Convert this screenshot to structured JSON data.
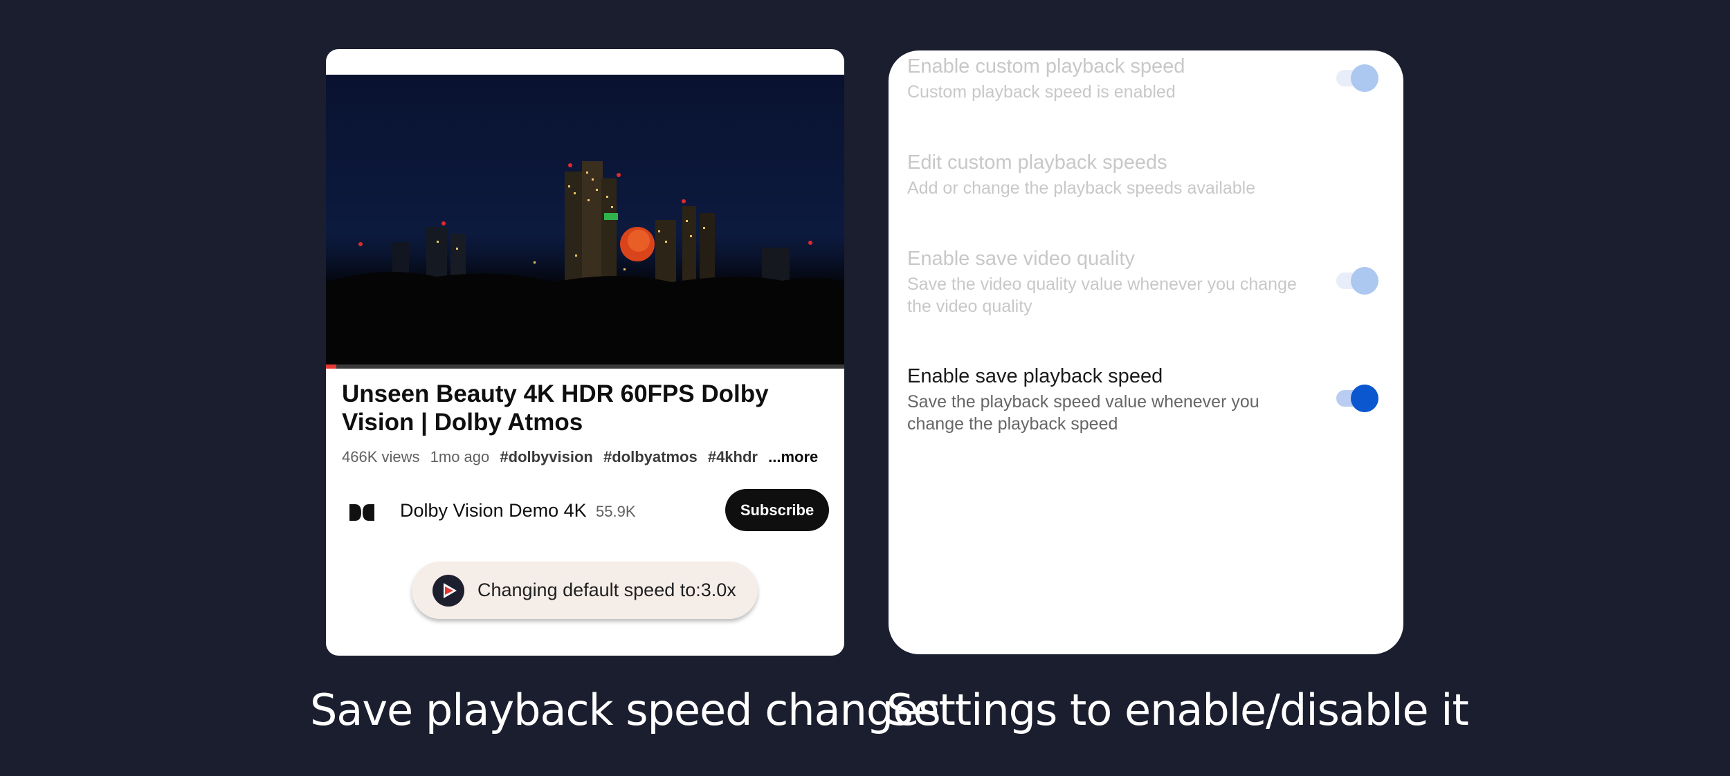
{
  "video": {
    "title": "Unseen Beauty 4K HDR 60FPS Dolby Vision | Dolby Atmos",
    "views": "466K views",
    "age": "1mo ago",
    "tags": [
      "#dolbyvision",
      "#dolbyatmos",
      "#4khdr"
    ],
    "more_label": "...more",
    "progress": 0.02
  },
  "channel": {
    "name": "Dolby Vision Demo 4K",
    "subscribers": "55.9K",
    "subscribe_label": "Subscribe",
    "logo_icon": "dolby-logo-icon"
  },
  "toast": {
    "text": "Changing default speed to:3.0x",
    "icon": "app-play-icon"
  },
  "settings": [
    {
      "title": "Enable custom playback speed",
      "description": "Custom playback speed is enabled",
      "has_toggle": true,
      "toggle_on": true,
      "enabled": false
    },
    {
      "title": "Edit custom playback speeds",
      "description": "Add or change the playback speeds available",
      "has_toggle": false,
      "enabled": false
    },
    {
      "title": "Enable save video quality",
      "description": "Save the video quality value whenever you change the video quality",
      "has_toggle": true,
      "toggle_on": true,
      "enabled": false
    },
    {
      "title": "Enable save playback speed",
      "description": "Save the playback speed value whenever you change the playback speed",
      "has_toggle": true,
      "toggle_on": true,
      "enabled": true
    }
  ],
  "captions": {
    "left": "Save playback speed changes",
    "right": "Settings to enable/disable it"
  },
  "colors": {
    "background": "#1b1e2e",
    "toggle_accent": "#0b57d0",
    "subscribe_button": "#0f0f0f",
    "progress": "#e53935"
  }
}
